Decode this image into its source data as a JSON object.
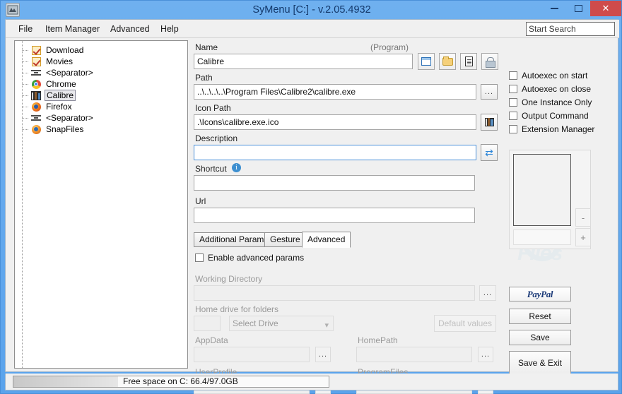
{
  "window": {
    "title": "SyMenu [C:] - v.2.05.4932",
    "app_icon": "symenu-app-icon",
    "minimize_label": "",
    "maximize_label": "",
    "close_label": "✕"
  },
  "menubar": {
    "items": [
      {
        "label": "File"
      },
      {
        "label": "Item Manager"
      },
      {
        "label": "Advanced"
      },
      {
        "label": "Help"
      }
    ],
    "search": {
      "value": "Start Search",
      "placeholder": "Start Search"
    }
  },
  "tree": {
    "nodes": [
      {
        "label": "Download",
        "icon": "checked-folder-icon"
      },
      {
        "label": "Movies",
        "icon": "checked-folder-icon"
      },
      {
        "label": "<Separator>",
        "icon": "separator-icon"
      },
      {
        "label": "Chrome",
        "icon": "chrome-icon"
      },
      {
        "label": "Calibre",
        "icon": "calibre-icon",
        "selected": true
      },
      {
        "label": "Firefox",
        "icon": "firefox-icon"
      },
      {
        "label": "<Separator>",
        "icon": "separator-icon"
      },
      {
        "label": "SnapFiles",
        "icon": "snapfiles-icon"
      }
    ]
  },
  "form": {
    "name_label": "Name",
    "name_type": "(Program)",
    "name_value": "Calibre",
    "type_buttons": [
      {
        "name": "program-type-button",
        "icon": "window-icon"
      },
      {
        "name": "folder-type-button",
        "icon": "folder-icon"
      },
      {
        "name": "document-type-button",
        "icon": "document-icon"
      },
      {
        "name": "secure-type-button",
        "icon": "lock-icon"
      }
    ],
    "path_label": "Path",
    "path_value": "..\\..\\..\\..\\Program Files\\Calibre2\\calibre.exe",
    "path_browse_label": "...",
    "icon_path_label": "Icon Path",
    "icon_path_value": ".\\Icons\\calibre.exe.ico",
    "icon_pick_label": "",
    "description_label": "Description",
    "description_value": "",
    "description_sync_label": "",
    "shortcut_label": "Shortcut",
    "shortcut_info_icon": "info-icon",
    "shortcut_value": "",
    "url_label": "Url",
    "url_value": ""
  },
  "tabs": [
    {
      "label": "Additional Params",
      "active": false
    },
    {
      "label": "Gesture",
      "active": false
    },
    {
      "label": "Advanced",
      "active": true
    }
  ],
  "advanced_panel": {
    "enable_label": "Enable advanced params",
    "enable_checked": false,
    "working_dir_label": "Working Directory",
    "working_dir_value": "",
    "working_dir_browse": "...",
    "home_drive_label": "Home drive for folders",
    "drive_letter_value": "",
    "select_drive_value": "Select Drive",
    "default_values_label": "Default values",
    "fields": [
      {
        "label": "AppData",
        "value": "",
        "browse": "..."
      },
      {
        "label": "HomePath",
        "value": "",
        "browse": "..."
      },
      {
        "label": "UserProfile",
        "value": "",
        "browse": "..."
      },
      {
        "label": "ProgramFiles",
        "value": "",
        "browse": "..."
      }
    ]
  },
  "options": {
    "checkboxes": [
      {
        "label": "Autoexec on start",
        "checked": false
      },
      {
        "label": "Autoexec on close",
        "checked": false
      },
      {
        "label": "One Instance Only",
        "checked": false
      },
      {
        "label": "Output Command",
        "checked": false
      },
      {
        "label": "Extension Manager",
        "checked": false
      }
    ],
    "preview_minus_label": "-",
    "preview_plus_label": "+"
  },
  "actions": {
    "paypal_label": "PayPal",
    "reset_label": "Reset",
    "save_label": "Save",
    "save_exit_label": "Save & Exit"
  },
  "statusbar": {
    "disk_text": "Free space on C: 66.4/97.0GB"
  },
  "watermark": {
    "text": "Files"
  },
  "colors": {
    "titlebar": "#5aa3ec",
    "close_button": "#cf4b4b",
    "focus_border": "#4a90d9",
    "paypal_blue": "#1b3a78"
  }
}
